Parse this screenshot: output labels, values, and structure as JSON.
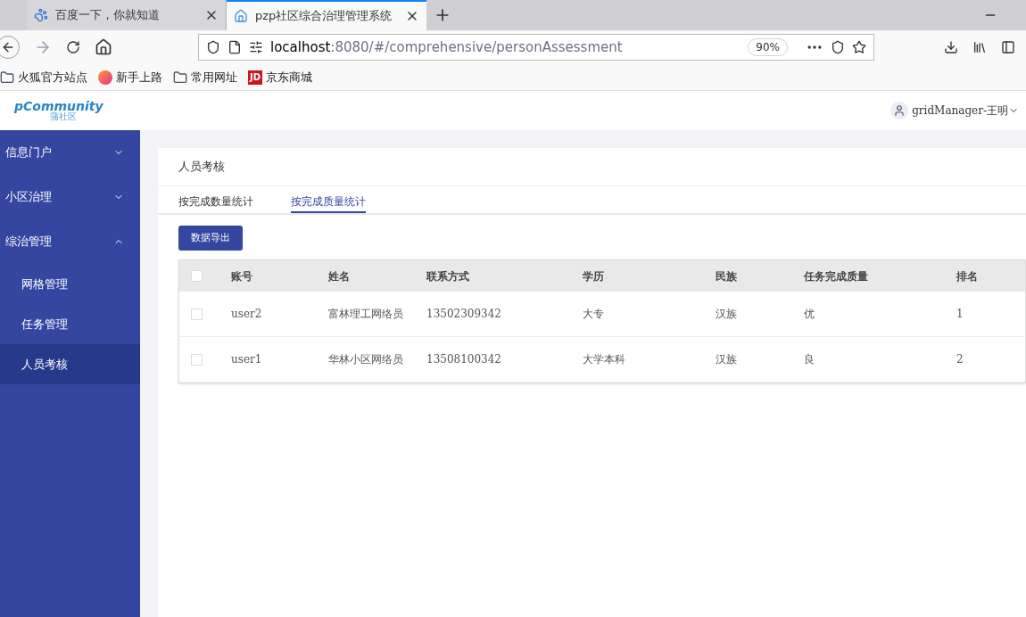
{
  "browser": {
    "tabs": [
      {
        "title": "百度一下，你就知道",
        "selected": false,
        "kind": "paw"
      },
      {
        "title": "pzp社区综合治理管理系统",
        "selected": true,
        "kind": "home"
      }
    ],
    "url_host": "localhost",
    "url_rest": ":8080/#/comprehensive/personAssessment",
    "zoom": "90%",
    "bookmarks": [
      {
        "label": "火狐官方站点",
        "kind": "folder"
      },
      {
        "label": "新手上路",
        "kind": "firefox"
      },
      {
        "label": "常用网址",
        "kind": "folder"
      },
      {
        "label": "京东商城",
        "kind": "jd",
        "badge": "JD"
      }
    ]
  },
  "header": {
    "logo_text": "pCommunity",
    "logo_sub": "蒲社区",
    "user": "gridManager-王明"
  },
  "sidebar": {
    "items": [
      {
        "label": "信息门户",
        "expanded": false
      },
      {
        "label": "小区治理",
        "expanded": false
      },
      {
        "label": "综治管理",
        "expanded": true,
        "children": [
          {
            "label": "网格管理",
            "selected": false
          },
          {
            "label": "任务管理",
            "selected": false
          },
          {
            "label": "人员考核",
            "selected": true
          }
        ]
      }
    ]
  },
  "page": {
    "title": "人员考核",
    "tabs": [
      {
        "label": "按完成数量统计",
        "selected": false
      },
      {
        "label": "按完成质量统计",
        "selected": true
      }
    ],
    "export_button": "数据导出",
    "table": {
      "header_checked": false,
      "columns": [
        "账号",
        "姓名",
        "联系方式",
        "学历",
        "民族",
        "任务完成质量",
        "排名"
      ],
      "rows": [
        {
          "checked": false,
          "cells": [
            "user2",
            "富林理工网络员",
            "13502309342",
            "大专",
            "汉族",
            "优",
            "1"
          ]
        },
        {
          "checked": false,
          "cells": [
            "user1",
            "华林小区网络员",
            "13508100342",
            "大学本科",
            "汉族",
            "良",
            "2"
          ]
        }
      ]
    }
  }
}
